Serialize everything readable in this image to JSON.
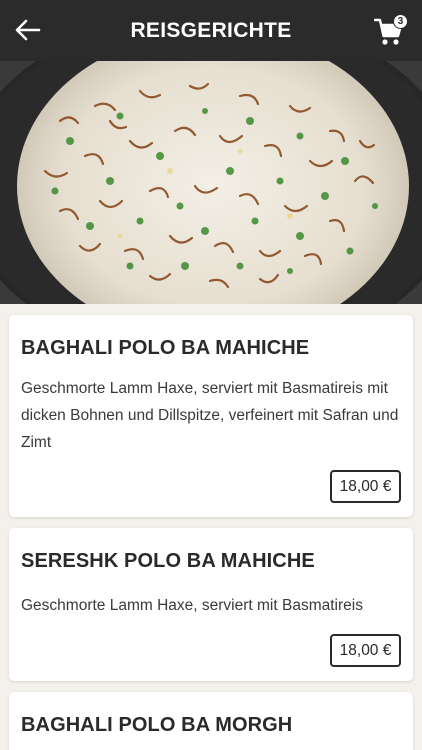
{
  "header": {
    "title": "REISGERICHTE",
    "back_icon": "arrow-left-icon",
    "cart_icon": "shopping-cart-icon",
    "cart_count": "3"
  },
  "hero": {
    "image": "rice-dish-photo"
  },
  "dishes": [
    {
      "name": "BAGHALI POLO BA MAHICHE",
      "description": "Geschmorte Lamm Haxe, serviert mit Basmatireis mit dicken Bohnen und Dillspitze, verfeinert mit Safran und Zimt",
      "price": "18,00 €"
    },
    {
      "name": "SERESHK POLO BA MAHICHE",
      "description": "Geschmorte Lamm Haxe, serviert mit Basmatireis",
      "price": "18,00 €"
    },
    {
      "name": "BAGHALI POLO BA MORGH"
    }
  ],
  "colors": {
    "header_bg": "#2b2b2b",
    "page_bg": "#f4f1ec",
    "card_bg": "#ffffff",
    "text": "#2a2a2a"
  }
}
